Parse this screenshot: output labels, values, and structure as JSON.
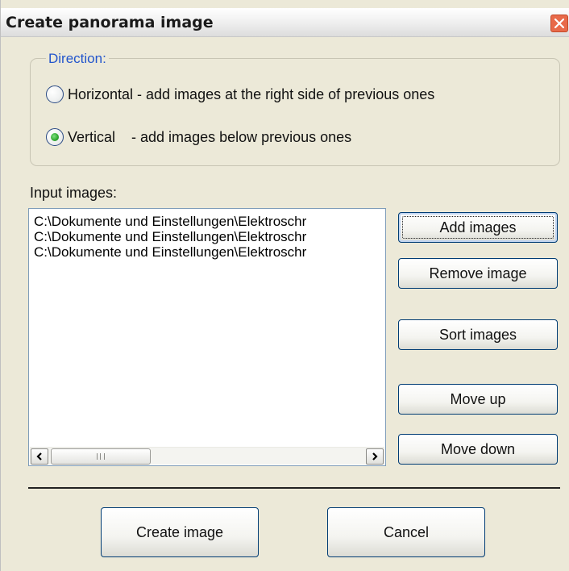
{
  "window": {
    "title": "Create panorama image"
  },
  "direction": {
    "legend": "Direction:",
    "options": [
      {
        "label": "Horizontal - add images at the right side of previous ones",
        "selected": false
      },
      {
        "label": "Vertical    - add images below previous ones",
        "selected": true
      }
    ]
  },
  "input_images": {
    "label": "Input images:",
    "items": [
      "C:\\Dokumente und Einstellungen\\Elektroschr",
      "C:\\Dokumente und Einstellungen\\Elektroschr",
      "C:\\Dokumente und Einstellungen\\Elektroschr"
    ]
  },
  "side_buttons": {
    "add": "Add images",
    "remove": "Remove image",
    "sort": "Sort images",
    "move_up": "Move up",
    "move_down": "Move down"
  },
  "bottom_buttons": {
    "create": "Create image",
    "cancel": "Cancel"
  },
  "colors": {
    "accent": "#2255cc",
    "selected_radio": "#2ea82e",
    "close_button": "#e86a4a"
  },
  "icons": {
    "close": "close-icon",
    "scroll_left": "chevron-left-icon",
    "scroll_right": "chevron-right-icon"
  }
}
